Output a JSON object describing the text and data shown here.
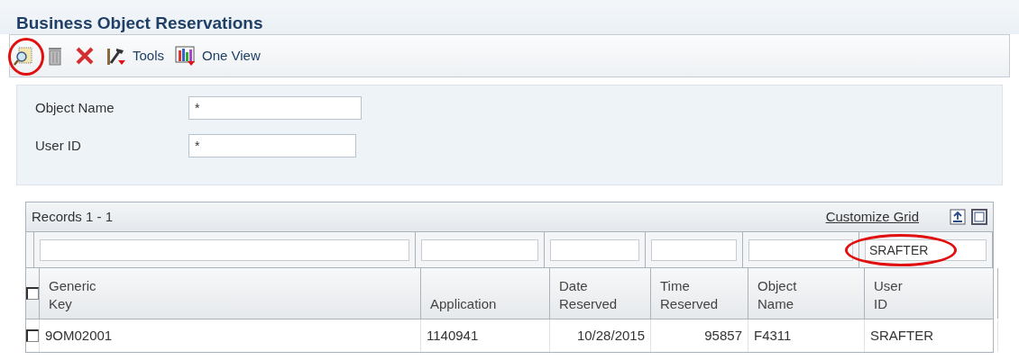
{
  "title": "Business Object Reservations",
  "toolbar": [
    {
      "kind": "find",
      "circled": true
    },
    {
      "kind": "delete",
      "circled": false
    },
    {
      "kind": "cancel",
      "circled": false
    },
    {
      "kind": "tools",
      "label": "Tools",
      "circled": false
    },
    {
      "kind": "oneview",
      "label": "One View",
      "circled": false
    }
  ],
  "form": [
    {
      "label": "Object Name",
      "value": "*"
    },
    {
      "label": "User ID",
      "value": "*"
    }
  ],
  "grid": {
    "records": "Records 1 - 1",
    "customize": "Customize Grid",
    "columns": [
      {
        "header": [
          "Generic",
          "Key"
        ],
        "circled": false
      },
      {
        "header": [
          "Application"
        ],
        "circled": false
      },
      {
        "header": [
          "Date",
          "Reserved"
        ],
        "circled": false
      },
      {
        "header": [
          "Time",
          "Reserved"
        ],
        "circled": false
      },
      {
        "header": [
          "Object",
          "Name"
        ],
        "circled": false
      },
      {
        "header": [
          "User",
          "ID"
        ],
        "filter": "SRAFTER",
        "circled": true
      }
    ],
    "header_checked": false,
    "rows": [
      {
        "checked": false,
        "cells": [
          "9OM02001",
          "1140941",
          "10/28/2015",
          "95857",
          "F4311",
          "SRAFTER"
        ]
      }
    ]
  }
}
